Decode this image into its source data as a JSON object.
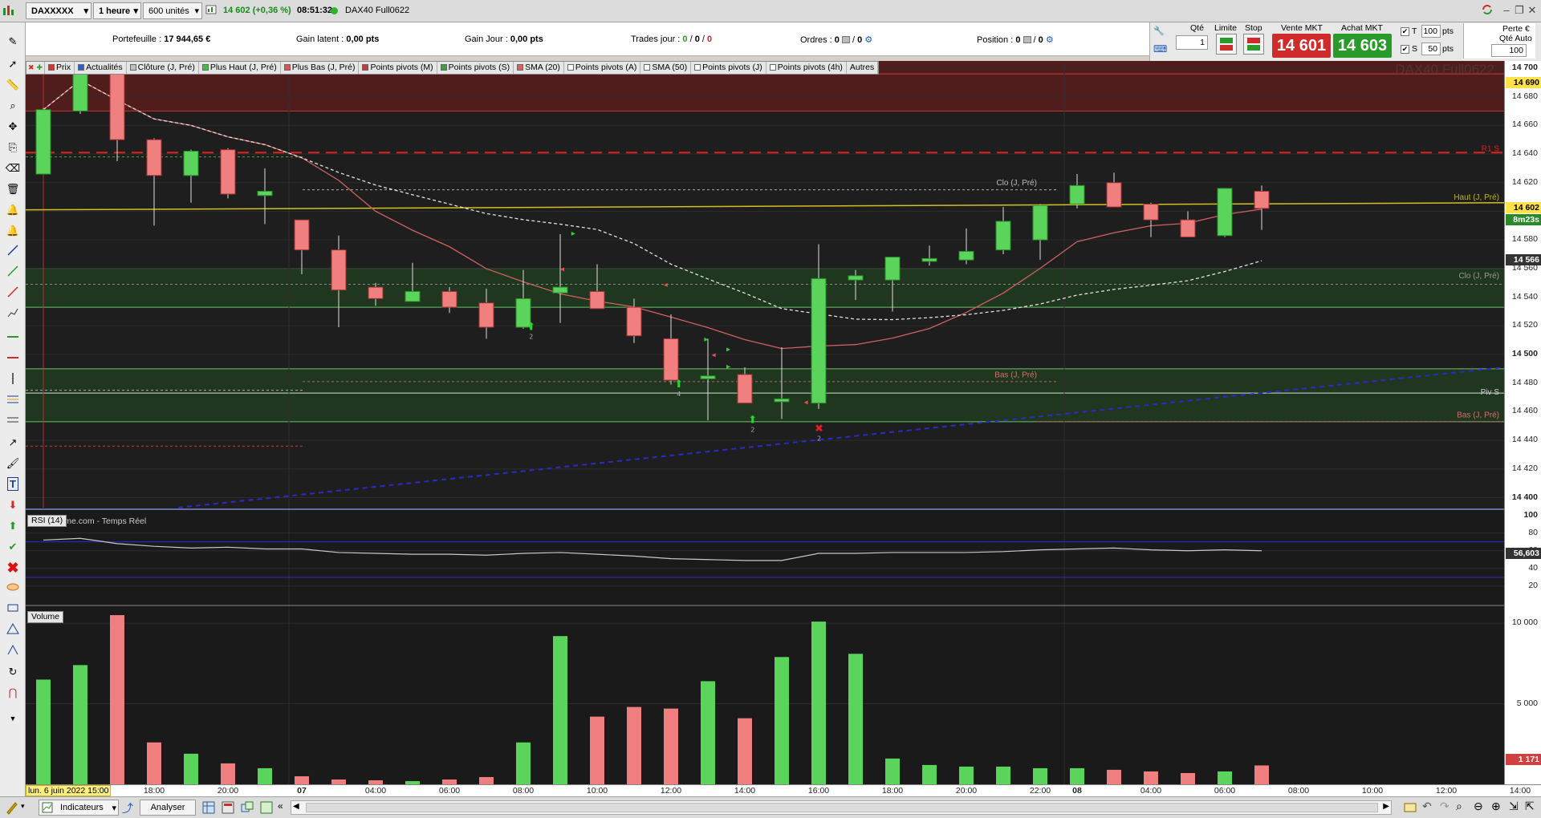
{
  "topbar": {
    "symbol": "DAXXXXX",
    "timeframe": "1 heure",
    "units": "600 unités",
    "quote": "14 602 (+0,36 %)",
    "time": "08:51:32",
    "instrument": "DAX40 Full0622"
  },
  "infobar": {
    "portefeuille_label": "Portefeuille :",
    "portefeuille_value": "17 944,65 €",
    "gain_latent_label": "Gain latent :",
    "gain_latent_value": "0,00 pts",
    "gain_jour_label": "Gain Jour :",
    "gain_jour_value": "0,00 pts",
    "trades_label": "Trades jour :",
    "trades_a": "0",
    "trades_b": "0",
    "trades_c": "0",
    "ordres_label": "Ordres :",
    "ordres_a": "0",
    "ordres_b": "0",
    "position_label": "Position :",
    "position_a": "0",
    "position_b": "0"
  },
  "order_panel": {
    "qte_label": "Qté",
    "qte_value": "1",
    "limite_label": "Limite",
    "stop_label": "Stop",
    "vente_label": "Vente MKT",
    "vente_value": "14 601",
    "achat_label": "Achat MKT",
    "achat_value": "14 603",
    "t_label": "T",
    "t_value": "100",
    "t_unit": "pts",
    "s_label": "S",
    "s_value": "50",
    "s_unit": "pts",
    "perte_label": "Perte €",
    "qte_auto_label": "Qté Auto",
    "qte_auto_value": "100"
  },
  "indicator_bar": [
    {
      "label": "Prix",
      "color": "#e03030"
    },
    {
      "label": "Actualités",
      "color": "#3060d0"
    },
    {
      "label": "Clôture (J, Pré)",
      "color": "#c0c0c0"
    },
    {
      "label": "Plus Haut (J, Pré)",
      "color": "#40c040"
    },
    {
      "label": "Plus Bas (J, Pré)",
      "color": "#e05050"
    },
    {
      "label": "Points pivots (M)",
      "color": "#c04040"
    },
    {
      "label": "Points pivots (S)",
      "color": "#40a040"
    },
    {
      "label": "SMA (20)",
      "color": "#e06060"
    },
    {
      "label": "Points pivots (A)",
      "color": "#ffffff"
    },
    {
      "label": "SMA (50)",
      "color": "#ffffff"
    },
    {
      "label": "Points pivots (J)",
      "color": "#ffffff"
    },
    {
      "label": "Points pivots (4h)",
      "color": "#ffffff"
    },
    {
      "label": "Autres",
      "color": ""
    }
  ],
  "chart_labels": {
    "watermark": "DAX40 Full0622",
    "source": "ProRealTime.com - Temps Réel",
    "r1s": "R1 S",
    "haut_jpre": "Haut (J, Pré)",
    "clo_jpre_top": "Clo (J, Pré)",
    "clo_jpre_right": "Clo (J, Pré)",
    "bas_jpre_mid": "Bas (J, Pré)",
    "bas_jpre_right": "Bas (J, Pré)",
    "piv_s": "Piv S"
  },
  "yaxis": {
    "ticks": [
      "14 700",
      "14 680",
      "14 660",
      "14 640",
      "14 620",
      "14 600",
      "14 580",
      "14 560",
      "14 540",
      "14 520",
      "14 500",
      "14 480",
      "14 460",
      "14 440",
      "14 420",
      "14 400"
    ],
    "price_label": "14 690",
    "current_price": "14 602",
    "countdown": "8m23s",
    "last_close": "14 566"
  },
  "rsi": {
    "label": "RSI (14)",
    "ticks": [
      "100",
      "80",
      "60",
      "40",
      "20"
    ],
    "current": "56,603"
  },
  "volume": {
    "label": "Volume",
    "ticks": [
      "10 000",
      "5 000"
    ],
    "current": "1 171"
  },
  "xaxis": {
    "start_label": "lun. 6 juin 2022 15:00",
    "ticks": [
      "18:00",
      "20:00",
      "07",
      "04:00",
      "06:00",
      "08:00",
      "10:00",
      "12:00",
      "14:00",
      "16:00",
      "18:00",
      "20:00",
      "22:00",
      "08",
      "04:00",
      "06:00",
      "08:00",
      "10:00",
      "12:00",
      "14:00"
    ]
  },
  "bottombar": {
    "indicateurs": "Indicateurs",
    "analyser": "Analyser"
  },
  "chart_data": {
    "type": "candlestick",
    "ylim": [
      14393,
      14705
    ],
    "candles": [
      {
        "o": 14626,
        "h": 14672,
        "l": 14626,
        "c": 14671
      },
      {
        "o": 14670,
        "h": 14715,
        "l": 14668,
        "c": 14712
      },
      {
        "o": 14710,
        "h": 14712,
        "l": 14635,
        "c": 14650
      },
      {
        "o": 14650,
        "h": 14651,
        "l": 14590,
        "c": 14625
      },
      {
        "o": 14625,
        "h": 14643,
        "l": 14606,
        "c": 14642
      },
      {
        "o": 14643,
        "h": 14644,
        "l": 14609,
        "c": 14612
      },
      {
        "o": 14611,
        "h": 14630,
        "l": 14591,
        "c": 14614
      },
      {
        "o": 14594,
        "h": 14594,
        "l": 14556,
        "c": 14573
      },
      {
        "o": 14573,
        "h": 14583,
        "l": 14519,
        "c": 14545
      },
      {
        "o": 14547,
        "h": 14550,
        "l": 14534,
        "c": 14539
      },
      {
        "o": 14537,
        "h": 14564,
        "l": 14537,
        "c": 14544
      },
      {
        "o": 14544,
        "h": 14547,
        "l": 14529,
        "c": 14533
      },
      {
        "o": 14536,
        "h": 14546,
        "l": 14511,
        "c": 14519
      },
      {
        "o": 14519,
        "h": 14559,
        "l": 14518,
        "c": 14539
      },
      {
        "o": 14543,
        "h": 14584,
        "l": 14522,
        "c": 14547
      },
      {
        "o": 14544,
        "h": 14563,
        "l": 14532,
        "c": 14532
      },
      {
        "o": 14533,
        "h": 14539,
        "l": 14508,
        "c": 14513
      },
      {
        "o": 14511,
        "h": 14528,
        "l": 14479,
        "c": 14482
      },
      {
        "o": 14483,
        "h": 14511,
        "l": 14454,
        "c": 14485
      },
      {
        "o": 14486,
        "h": 14491,
        "l": 14466,
        "c": 14466
      },
      {
        "o": 14467,
        "h": 14505,
        "l": 14455,
        "c": 14469
      },
      {
        "o": 14466,
        "h": 14577,
        "l": 14462,
        "c": 14553
      },
      {
        "o": 14552,
        "h": 14559,
        "l": 14538,
        "c": 14555
      },
      {
        "o": 14552,
        "h": 14568,
        "l": 14530,
        "c": 14568
      },
      {
        "o": 14565,
        "h": 14576,
        "l": 14562,
        "c": 14567
      },
      {
        "o": 14566,
        "h": 14588,
        "l": 14563,
        "c": 14572
      },
      {
        "o": 14573,
        "h": 14603,
        "l": 14570,
        "c": 14593
      },
      {
        "o": 14580,
        "h": 14605,
        "l": 14566,
        "c": 14604
      },
      {
        "o": 14605,
        "h": 14626,
        "l": 14602,
        "c": 14618
      },
      {
        "o": 14620,
        "h": 14627,
        "l": 14603,
        "c": 14603
      },
      {
        "o": 14605,
        "h": 14606,
        "l": 14582,
        "c": 14594
      },
      {
        "o": 14594,
        "h": 14600,
        "l": 14582,
        "c": 14582
      },
      {
        "o": 14583,
        "h": 14616,
        "l": 14582,
        "c": 14616
      },
      {
        "o": 14614,
        "h": 14618,
        "l": 14587,
        "c": 14602
      }
    ],
    "volume": [
      6500,
      7400,
      10500,
      2600,
      1900,
      1300,
      1000,
      500,
      300,
      250,
      200,
      300,
      450,
      2600,
      9200,
      4200,
      4800,
      4700,
      6400,
      4100,
      7900,
      10100,
      8100,
      1600,
      1200,
      1100,
      1100,
      1000,
      1000,
      900,
      800,
      700,
      800,
      1171
    ],
    "rsi": [
      72,
      74,
      68,
      65,
      63,
      64,
      62,
      62,
      58,
      57,
      56,
      56,
      55,
      57,
      58,
      56,
      54,
      51,
      50,
      49,
      49,
      57,
      57,
      58,
      58,
      58,
      59,
      61,
      62,
      63,
      61,
      60,
      61,
      60,
      56.603
    ],
    "levels": {
      "r1s": 14641,
      "haut_jpre": 14605,
      "clo_jpre": 14549,
      "zone_top": 14560,
      "zone_bottom": 14533,
      "zone2_top": 14490,
      "piv_s": 14473,
      "bas_jpre": 14453,
      "red_zone_top": 14705,
      "red_zone_bottom": 14670
    }
  }
}
